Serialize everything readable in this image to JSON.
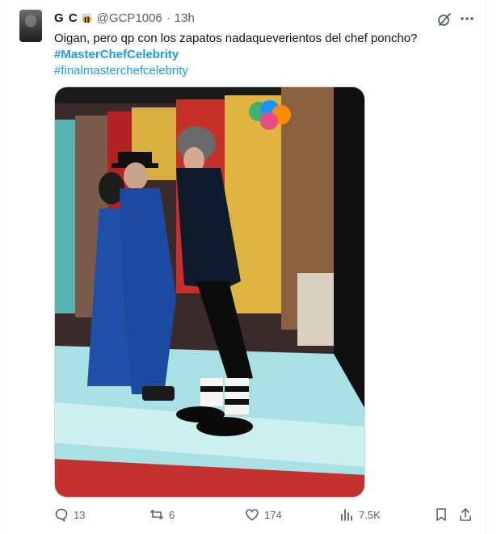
{
  "tweet": {
    "author_name": "G C",
    "handle": "@GCP1006",
    "separator": "·",
    "time": "13h",
    "text": "Oigan, pero qp con los zapatos nadaqueverientos del chef poncho?",
    "hashtags": [
      "#MasterChefCelebrity",
      "#finalmasterchefcelebrity"
    ]
  },
  "actions": {
    "replies": "13",
    "reposts": "6",
    "likes": "174",
    "views": "7.5K"
  },
  "icons": {
    "author_badge": "bee-emoji-icon",
    "grok": "grok-icon",
    "more": "more-icon",
    "reply": "reply-icon",
    "repost": "repost-icon",
    "like": "like-icon",
    "views": "views-icon",
    "bookmark": "bookmark-icon",
    "share": "share-icon"
  },
  "colors": {
    "link": "#1d9bf0",
    "secondary_text": "#536471",
    "primary_text": "#0f1419"
  }
}
